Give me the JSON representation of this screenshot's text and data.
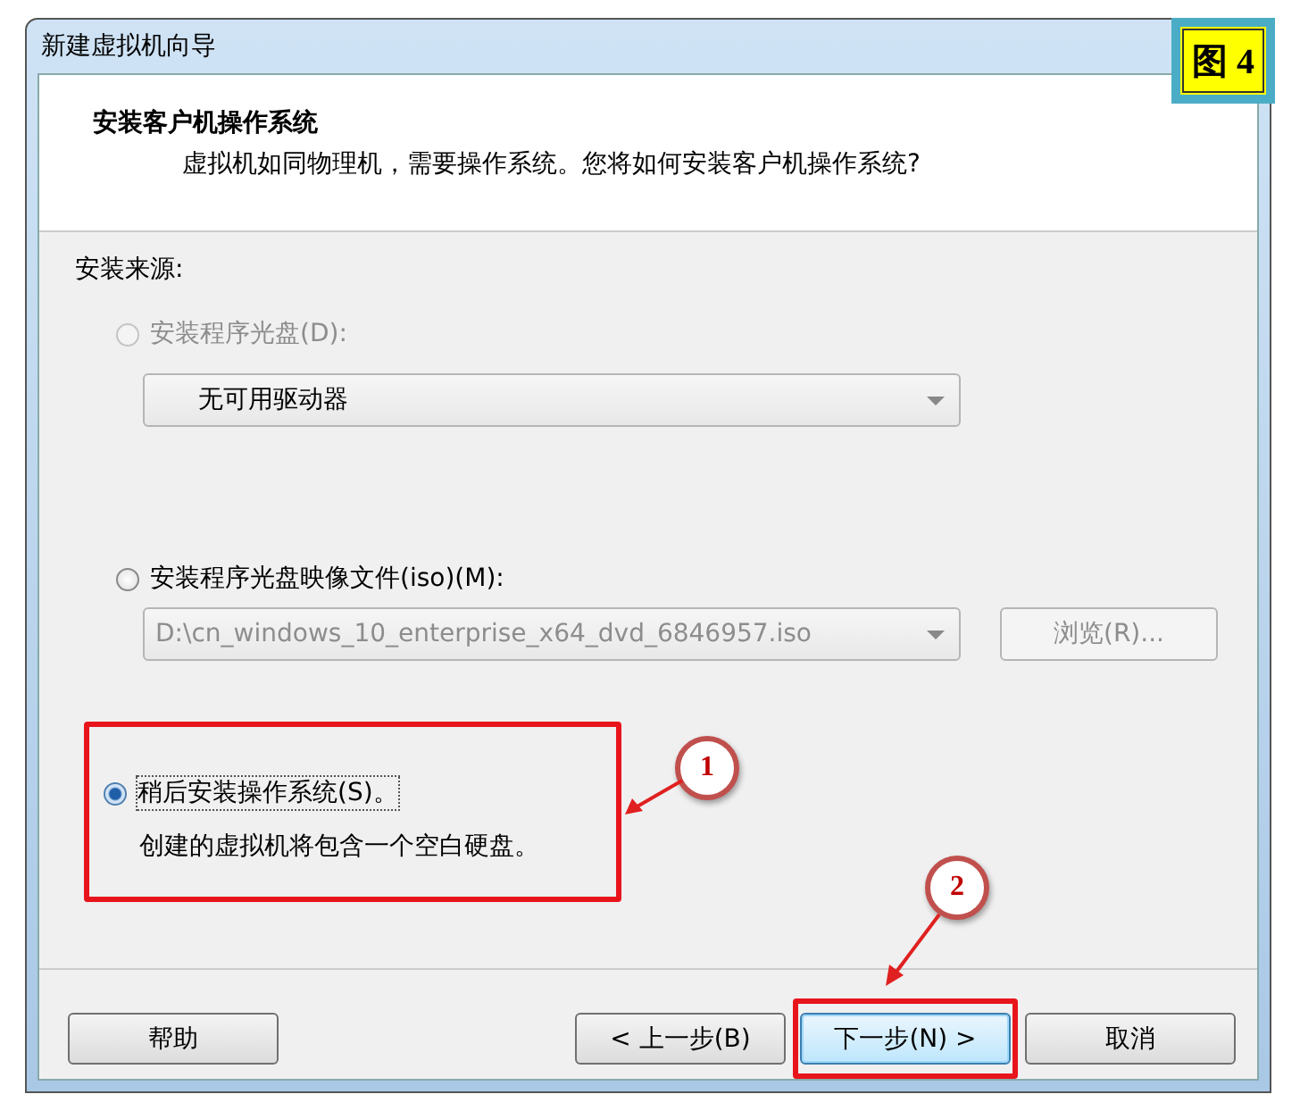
{
  "window": {
    "title": "新建虚拟机向导"
  },
  "figure_label": "图 4",
  "header": {
    "title": "安装客户机操作系统",
    "subtitle": "虚拟机如同物理机，需要操作系统。您将如何安装客户机操作系统?"
  },
  "source_label": "安装来源:",
  "options": [
    {
      "kind": "disc",
      "label": "安装程序光盘(D):",
      "selected": false,
      "disabled": true,
      "dropdown": "无可用驱动器"
    },
    {
      "kind": "iso",
      "label": "安装程序光盘映像文件(iso)(M):",
      "selected": false,
      "disabled": false,
      "dropdown": "D:\\cn_windows_10_enterprise_x64_dvd_6846957.iso",
      "browse": "浏览(R)..."
    },
    {
      "kind": "later",
      "label": "稍后安装操作系统(S)。",
      "selected": true,
      "disabled": false,
      "note": "创建的虚拟机将包含一个空白硬盘。",
      "callout": "1"
    }
  ],
  "buttons": [
    {
      "label": "帮助",
      "default": false
    },
    {
      "label": "< 上一步(B)",
      "default": false
    },
    {
      "label": "下一步(N) >",
      "default": true,
      "callout": "2"
    },
    {
      "label": "取消",
      "default": false
    }
  ]
}
